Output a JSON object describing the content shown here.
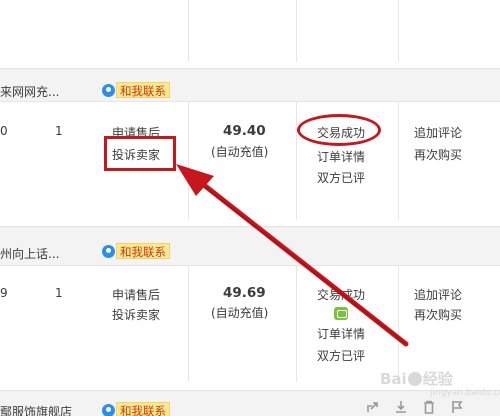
{
  "orders": [
    {
      "shop_name": "来网网充...",
      "contact_label": "和我联系",
      "col0": "0",
      "qty": "1",
      "service": [
        "申请售后",
        "投诉卖家"
      ],
      "price": "49.40",
      "price_note": "(自动充值)",
      "status": "交易成功",
      "detail_links": [
        "订单详情",
        "双方已评"
      ],
      "actions": [
        "追加评论",
        "再次购买"
      ]
    },
    {
      "shop_name": "州向上话...",
      "contact_label": "和我联系",
      "col0": "9",
      "qty": "1",
      "service": [
        "申请售后",
        "投诉卖家"
      ],
      "price": "49.69",
      "price_note": "(自动充值)",
      "status": "交易成功",
      "detail_links": [
        "订单详情",
        "双方已评"
      ],
      "actions": [
        "追加评论",
        "再次购买"
      ]
    },
    {
      "shop_name": "鄢服饰旗舰店",
      "contact_label": "和我联系"
    }
  ],
  "annotation_color": "#c8161d",
  "contact_bubble_color": "#2b8ee8",
  "contact_badge_color": "#fde98f",
  "toolbar_icons": [
    "share-icon",
    "download-icon",
    "trash-icon",
    "flag-icon"
  ],
  "watermark": {
    "brand_left": "Bai",
    "brand_right": "经验",
    "sub": "jingyan.baidu.com"
  }
}
